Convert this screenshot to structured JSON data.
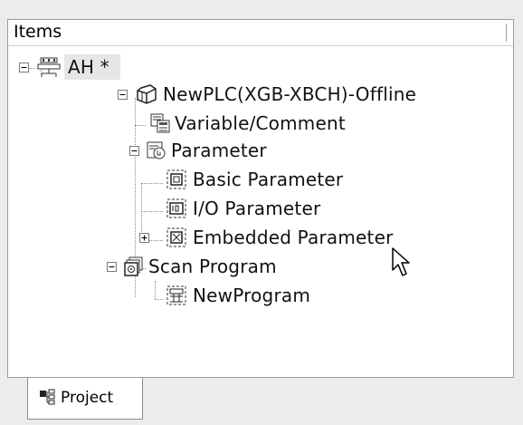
{
  "header": {
    "title": "Items"
  },
  "tree": {
    "nodes": [
      {
        "label": "AH *",
        "icon": "ah-network-icon",
        "expander": "minus",
        "selected": true
      },
      {
        "label": "NewPLC(XGB-XBCH)-Offline",
        "icon": "plc-cube-icon",
        "expander": "minus"
      },
      {
        "label": "Variable/Comment",
        "icon": "variable-comment-icon"
      },
      {
        "label": "Parameter",
        "icon": "parameter-icon",
        "expander": "minus"
      },
      {
        "label": "Basic Parameter",
        "icon": "basic-parameter-icon"
      },
      {
        "label": "I/O Parameter",
        "icon": "io-parameter-icon"
      },
      {
        "label": "Embedded Parameter",
        "icon": "embedded-parameter-icon",
        "expander": "plus"
      },
      {
        "label": "Scan Program",
        "icon": "scan-program-icon",
        "expander": "minus"
      },
      {
        "label": "NewProgram",
        "icon": "new-program-icon"
      }
    ]
  },
  "tabs": [
    {
      "label": "Project",
      "icon": "project-tab-icon",
      "active": true
    }
  ],
  "colors": {
    "selection": "#e6e6e6",
    "panel": "#ffffff",
    "background": "#ececec",
    "icon_accent": "#3a3a3a"
  }
}
